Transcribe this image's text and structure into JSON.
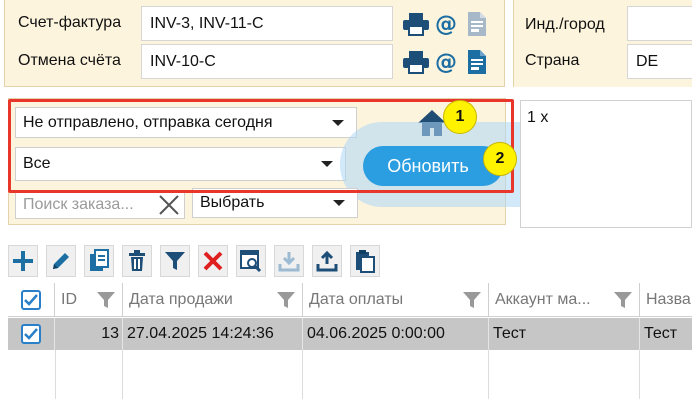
{
  "invoice_panel": {
    "invoice_label": "Счет-фактура",
    "invoice_value": "INV-3, INV-11-C",
    "cancel_label": "Отмена счёта",
    "cancel_value": "INV-10-C"
  },
  "right_panel": {
    "zip_city_label": "Инд./город",
    "zip_city_value": "",
    "country_label": "Страна",
    "country_value": "DE"
  },
  "filters": {
    "status_select": "Не отправлено, отправка сегодня",
    "scope_select": "Все",
    "search_placeholder": "Поиск заказа...",
    "choose_select": "Выбрать",
    "refresh_button": "Обновить"
  },
  "annotations": {
    "badge_1": "1",
    "badge_2": "2"
  },
  "note": {
    "text": "1 x"
  },
  "icons": {
    "accent_color": "#2a9ee0",
    "highlight_color": "#e8372a",
    "badge_color": "#fff200",
    "toolbar": [
      "add-icon",
      "edit-icon",
      "copy-icon",
      "delete-icon",
      "filter-icon",
      "clear-filter-icon",
      "search-doc-icon",
      "import-icon",
      "export-icon",
      "paste-icon"
    ]
  },
  "table": {
    "columns": [
      "ID",
      "Дата продажи",
      "Дата оплаты",
      "Аккаунт ма...",
      "Назва"
    ],
    "rows": [
      {
        "id": "13",
        "sale_date": "27.04.2025 14:24:36",
        "pay_date": "04.06.2025 0:00:00",
        "account": "Тест",
        "name": "Тест"
      }
    ]
  }
}
